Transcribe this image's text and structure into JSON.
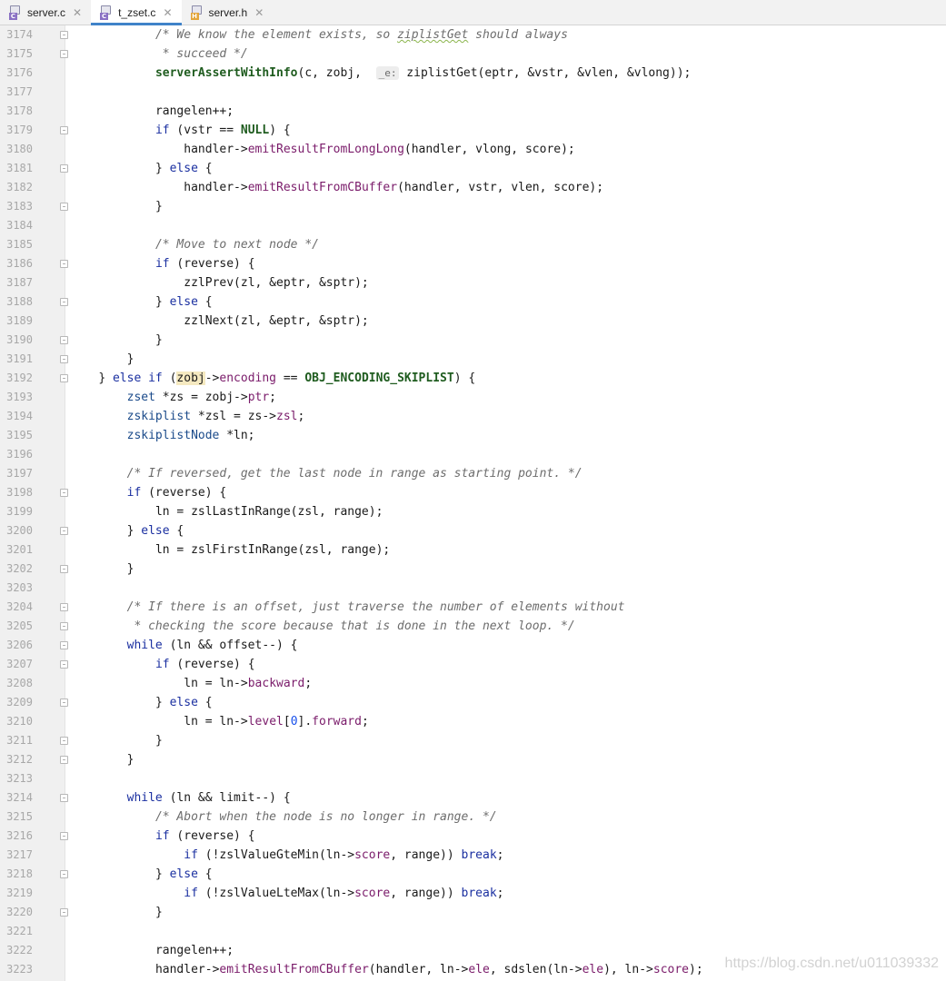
{
  "tabs": [
    {
      "label": "server.c",
      "type": "c",
      "active": false
    },
    {
      "label": "t_zset.c",
      "type": "c",
      "active": true
    },
    {
      "label": "server.h",
      "type": "h",
      "active": false
    }
  ],
  "lines": [
    {
      "n": "3174",
      "fold": true,
      "indent": 3,
      "code": [
        {
          "t": "/* We know the element exists, so ",
          "c": "cm"
        },
        {
          "t": "ziplistGet",
          "c": "cm squig"
        },
        {
          "t": " should always",
          "c": "cm"
        }
      ]
    },
    {
      "n": "3175",
      "fold": true,
      "indent": 3,
      "code": [
        {
          "t": " * succeed */",
          "c": "cm"
        }
      ]
    },
    {
      "n": "3176",
      "fold": false,
      "indent": 3,
      "code": [
        {
          "t": "serverAssertWithInfo",
          "c": "fnb"
        },
        {
          "t": "(c, zobj,  "
        },
        {
          "t": "_e:",
          "c": "hint"
        },
        {
          "t": " ziplistGet(eptr, &vstr, &vlen, &vlong));"
        }
      ]
    },
    {
      "n": "3177",
      "fold": false,
      "indent": 0,
      "code": []
    },
    {
      "n": "3178",
      "fold": false,
      "indent": 3,
      "code": [
        {
          "t": "rangelen++;"
        }
      ]
    },
    {
      "n": "3179",
      "fold": true,
      "indent": 3,
      "code": [
        {
          "t": "if",
          "c": "kw"
        },
        {
          "t": " (vstr == "
        },
        {
          "t": "NULL",
          "c": "macro"
        },
        {
          "t": ") {"
        }
      ]
    },
    {
      "n": "3180",
      "fold": false,
      "indent": 4,
      "code": [
        {
          "t": "handler->"
        },
        {
          "t": "emitResultFromLongLong",
          "c": "call"
        },
        {
          "t": "(handler, vlong, score);"
        }
      ]
    },
    {
      "n": "3181",
      "fold": true,
      "indent": 3,
      "code": [
        {
          "t": "} "
        },
        {
          "t": "else",
          "c": "kw"
        },
        {
          "t": " {"
        }
      ]
    },
    {
      "n": "3182",
      "fold": false,
      "indent": 4,
      "code": [
        {
          "t": "handler->"
        },
        {
          "t": "emitResultFromCBuffer",
          "c": "call"
        },
        {
          "t": "(handler, vstr, vlen, score);"
        }
      ]
    },
    {
      "n": "3183",
      "fold": true,
      "indent": 3,
      "code": [
        {
          "t": "}"
        }
      ]
    },
    {
      "n": "3184",
      "fold": false,
      "indent": 0,
      "code": []
    },
    {
      "n": "3185",
      "fold": false,
      "indent": 3,
      "code": [
        {
          "t": "/* Move to next node */",
          "c": "cm"
        }
      ]
    },
    {
      "n": "3186",
      "fold": true,
      "indent": 3,
      "code": [
        {
          "t": "if",
          "c": "kw"
        },
        {
          "t": " (reverse) {"
        }
      ]
    },
    {
      "n": "3187",
      "fold": false,
      "indent": 4,
      "code": [
        {
          "t": "zzlPrev(zl, &eptr, &sptr);"
        }
      ]
    },
    {
      "n": "3188",
      "fold": true,
      "indent": 3,
      "code": [
        {
          "t": "} "
        },
        {
          "t": "else",
          "c": "kw"
        },
        {
          "t": " {"
        }
      ]
    },
    {
      "n": "3189",
      "fold": false,
      "indent": 4,
      "code": [
        {
          "t": "zzlNext(zl, &eptr, &sptr);"
        }
      ]
    },
    {
      "n": "3190",
      "fold": true,
      "indent": 3,
      "code": [
        {
          "t": "}"
        }
      ]
    },
    {
      "n": "3191",
      "fold": true,
      "indent": 2,
      "code": [
        {
          "t": "}"
        }
      ]
    },
    {
      "n": "3192",
      "fold": true,
      "indent": 1,
      "code": [
        {
          "t": "} "
        },
        {
          "t": "else if",
          "c": "kw"
        },
        {
          "t": " ("
        },
        {
          "t": "zobj",
          "c": "hl"
        },
        {
          "t": "->"
        },
        {
          "t": "encoding",
          "c": "field"
        },
        {
          "t": " == "
        },
        {
          "t": "OBJ_ENCODING_SKIPLIST",
          "c": "macro"
        },
        {
          "t": ") {"
        }
      ]
    },
    {
      "n": "3193",
      "fold": false,
      "indent": 2,
      "code": [
        {
          "t": "zset",
          "c": "type"
        },
        {
          "t": " *zs = zobj->"
        },
        {
          "t": "ptr",
          "c": "field"
        },
        {
          "t": ";"
        }
      ]
    },
    {
      "n": "3194",
      "fold": false,
      "indent": 2,
      "code": [
        {
          "t": "zskiplist",
          "c": "type"
        },
        {
          "t": " *zsl = zs->"
        },
        {
          "t": "zsl",
          "c": "field"
        },
        {
          "t": ";"
        }
      ]
    },
    {
      "n": "3195",
      "fold": false,
      "indent": 2,
      "code": [
        {
          "t": "zskiplistNode",
          "c": "type"
        },
        {
          "t": " *ln;"
        }
      ]
    },
    {
      "n": "3196",
      "fold": false,
      "indent": 0,
      "code": []
    },
    {
      "n": "3197",
      "fold": false,
      "indent": 2,
      "code": [
        {
          "t": "/* If reversed, get the last node in range as starting point. */",
          "c": "cm"
        }
      ]
    },
    {
      "n": "3198",
      "fold": true,
      "indent": 2,
      "code": [
        {
          "t": "if",
          "c": "kw"
        },
        {
          "t": " (reverse) {"
        }
      ]
    },
    {
      "n": "3199",
      "fold": false,
      "indent": 3,
      "code": [
        {
          "t": "ln = zslLastInRange(zsl, range);"
        }
      ]
    },
    {
      "n": "3200",
      "fold": true,
      "indent": 2,
      "code": [
        {
          "t": "} "
        },
        {
          "t": "else",
          "c": "kw"
        },
        {
          "t": " {"
        }
      ]
    },
    {
      "n": "3201",
      "fold": false,
      "indent": 3,
      "code": [
        {
          "t": "ln = zslFirstInRange(zsl, range);"
        }
      ]
    },
    {
      "n": "3202",
      "fold": true,
      "indent": 2,
      "code": [
        {
          "t": "}"
        }
      ]
    },
    {
      "n": "3203",
      "fold": false,
      "indent": 0,
      "code": []
    },
    {
      "n": "3204",
      "fold": true,
      "indent": 2,
      "code": [
        {
          "t": "/* If there is an offset, just traverse the number of elements without",
          "c": "cm"
        }
      ]
    },
    {
      "n": "3205",
      "fold": true,
      "indent": 2,
      "code": [
        {
          "t": " * checking the score because that is done in the next loop. */",
          "c": "cm"
        }
      ]
    },
    {
      "n": "3206",
      "fold": true,
      "indent": 2,
      "code": [
        {
          "t": "while",
          "c": "kw"
        },
        {
          "t": " (ln && offset--) {"
        }
      ]
    },
    {
      "n": "3207",
      "fold": true,
      "indent": 3,
      "code": [
        {
          "t": "if",
          "c": "kw"
        },
        {
          "t": " (reverse) {"
        }
      ]
    },
    {
      "n": "3208",
      "fold": false,
      "indent": 4,
      "code": [
        {
          "t": "ln = ln->"
        },
        {
          "t": "backward",
          "c": "field"
        },
        {
          "t": ";"
        }
      ]
    },
    {
      "n": "3209",
      "fold": true,
      "indent": 3,
      "code": [
        {
          "t": "} "
        },
        {
          "t": "else",
          "c": "kw"
        },
        {
          "t": " {"
        }
      ]
    },
    {
      "n": "3210",
      "fold": false,
      "indent": 4,
      "code": [
        {
          "t": "ln = ln->"
        },
        {
          "t": "level",
          "c": "field"
        },
        {
          "t": "["
        },
        {
          "t": "0",
          "c": "num"
        },
        {
          "t": "]."
        },
        {
          "t": "forward",
          "c": "field"
        },
        {
          "t": ";"
        }
      ]
    },
    {
      "n": "3211",
      "fold": true,
      "indent": 3,
      "code": [
        {
          "t": "}"
        }
      ]
    },
    {
      "n": "3212",
      "fold": true,
      "indent": 2,
      "code": [
        {
          "t": "}"
        }
      ]
    },
    {
      "n": "3213",
      "fold": false,
      "indent": 0,
      "code": []
    },
    {
      "n": "3214",
      "fold": true,
      "indent": 2,
      "code": [
        {
          "t": "while",
          "c": "kw"
        },
        {
          "t": " (ln && limit--) {"
        }
      ]
    },
    {
      "n": "3215",
      "fold": false,
      "indent": 3,
      "code": [
        {
          "t": "/* Abort when the node is no longer in range. */",
          "c": "cm"
        }
      ]
    },
    {
      "n": "3216",
      "fold": true,
      "indent": 3,
      "code": [
        {
          "t": "if",
          "c": "kw"
        },
        {
          "t": " (reverse) {"
        }
      ]
    },
    {
      "n": "3217",
      "fold": false,
      "indent": 4,
      "code": [
        {
          "t": "if",
          "c": "kw"
        },
        {
          "t": " (!zslValueGteMin(ln->"
        },
        {
          "t": "score",
          "c": "field"
        },
        {
          "t": ", range)) "
        },
        {
          "t": "break",
          "c": "kw"
        },
        {
          "t": ";"
        }
      ]
    },
    {
      "n": "3218",
      "fold": true,
      "indent": 3,
      "code": [
        {
          "t": "} "
        },
        {
          "t": "else",
          "c": "kw"
        },
        {
          "t": " {"
        }
      ]
    },
    {
      "n": "3219",
      "fold": false,
      "indent": 4,
      "code": [
        {
          "t": "if",
          "c": "kw"
        },
        {
          "t": " (!zslValueLteMax(ln->"
        },
        {
          "t": "score",
          "c": "field"
        },
        {
          "t": ", range)) "
        },
        {
          "t": "break",
          "c": "kw"
        },
        {
          "t": ";"
        }
      ]
    },
    {
      "n": "3220",
      "fold": true,
      "indent": 3,
      "code": [
        {
          "t": "}"
        }
      ]
    },
    {
      "n": "3221",
      "fold": false,
      "indent": 0,
      "code": []
    },
    {
      "n": "3222",
      "fold": false,
      "indent": 3,
      "code": [
        {
          "t": "rangelen++;"
        }
      ]
    },
    {
      "n": "3223",
      "fold": false,
      "indent": 3,
      "code": [
        {
          "t": "handler->"
        },
        {
          "t": "emitResultFromCBuffer",
          "c": "call"
        },
        {
          "t": "(handler, ln->"
        },
        {
          "t": "ele",
          "c": "field"
        },
        {
          "t": ", sdslen(ln->"
        },
        {
          "t": "ele",
          "c": "field"
        },
        {
          "t": "), ln->"
        },
        {
          "t": "score",
          "c": "field"
        },
        {
          "t": ");"
        }
      ]
    }
  ],
  "watermark": "https://blog.csdn.net/u011039332"
}
